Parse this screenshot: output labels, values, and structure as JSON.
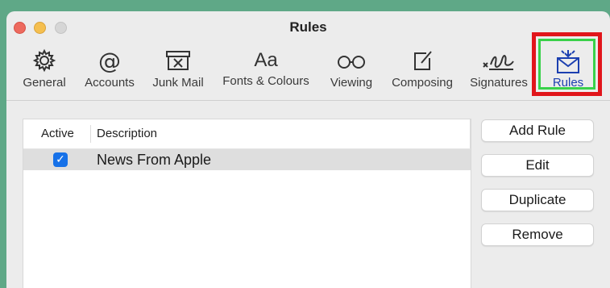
{
  "window": {
    "title": "Rules"
  },
  "toolbar": {
    "items": [
      {
        "label": "General",
        "icon": "gear-icon"
      },
      {
        "label": "Accounts",
        "icon": "at-sign-icon"
      },
      {
        "label": "Junk Mail",
        "icon": "junk-tray-icon"
      },
      {
        "label": "Fonts & Colours",
        "icon": "fonts-icon",
        "glyph": "Aa"
      },
      {
        "label": "Viewing",
        "icon": "glasses-icon"
      },
      {
        "label": "Composing",
        "icon": "compose-icon"
      },
      {
        "label": "Signatures",
        "icon": "signature-icon"
      },
      {
        "label": "Rules",
        "icon": "rules-envelope-icon",
        "selected": true
      }
    ]
  },
  "table": {
    "headers": {
      "active": "Active",
      "description": "Description"
    },
    "rows": [
      {
        "active": true,
        "description": "News From Apple"
      }
    ]
  },
  "buttons": {
    "add_rule": "Add Rule",
    "edit": "Edit",
    "duplicate": "Duplicate",
    "remove": "Remove"
  },
  "colors": {
    "background": "#5fa887",
    "highlight_red": "#e1151b",
    "highlight_green": "#39d14a",
    "accent_blue": "#1671e8",
    "selected_label": "#1b3fb0"
  }
}
